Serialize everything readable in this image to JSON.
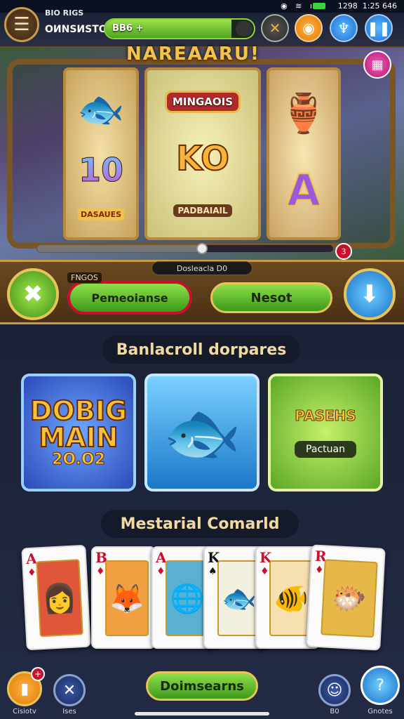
{
  "status_bar": {
    "time": "1:25 646",
    "date": "1298",
    "icons": "◉ ≋ ıl"
  },
  "header": {
    "menu_icon": "hamburger-icon",
    "player_name": "BIO RIGS",
    "player_subtitle": "ОИNSИSTOA",
    "xp_text": "BB6 +",
    "xp_progress": 0.85,
    "buttons": [
      "close-x-icon",
      "coin-icon",
      "gift-icon",
      "pause-icon"
    ],
    "colors": {
      "xp": "#6bc82e",
      "accent_orange": "#f08a12",
      "accent_blue": "#1e7fe0"
    }
  },
  "slot": {
    "title": "NAREAARU!",
    "reels": [
      {
        "top_symbol": "fish-icon",
        "bottom_big": "10",
        "bottom_label": "DASAUES"
      },
      {
        "top_label": "MINGAOIS",
        "middle_big": "KO",
        "middle_label": "PADBAIAIL"
      },
      {
        "top_symbol": "bottle-icon",
        "bottom_big": "A"
      }
    ],
    "spin_progress": 0.55,
    "badge": "3",
    "corner_icon": "gift-box-icon"
  },
  "controls": {
    "label": "Dosleacla D0",
    "bet_tag": "FNGOS",
    "bet_button": "Pemeoianse",
    "reset_button": "Nesot",
    "left_icon": "back-arrow-icon",
    "right_icon": "down-arrow-icon"
  },
  "featured": {
    "title": "Banlacroll dorpares",
    "tiles": [
      {
        "big": "DOBIG",
        "big2": "MAIN",
        "sub": "2O.O2",
        "type": "banner"
      },
      {
        "icon": "fish-icon",
        "type": "image"
      },
      {
        "big": "PASEHS",
        "pill": "Pactuan",
        "type": "banner"
      }
    ]
  },
  "cards_section": {
    "title": "Mestarial Comarld",
    "cards": [
      {
        "rank": "A",
        "suit": "♦"
      },
      {
        "rank": "B",
        "suit": "♦"
      },
      {
        "rank": "A",
        "suit": "♦"
      },
      {
        "rank": "K",
        "suit": "♠"
      },
      {
        "rank": "K",
        "suit": "♦"
      },
      {
        "rank": "R",
        "suit": "♦"
      }
    ]
  },
  "bottom_nav": {
    "items": [
      {
        "label": "Cisiotv",
        "icon": "book-icon",
        "badge": "+"
      },
      {
        "label": "Ises",
        "icon": "tools-icon"
      },
      {
        "label": "B0",
        "icon": "profile-icon"
      },
      {
        "label": "Gnotes",
        "icon": "question-icon"
      }
    ],
    "main_button": "Doimsearns"
  }
}
